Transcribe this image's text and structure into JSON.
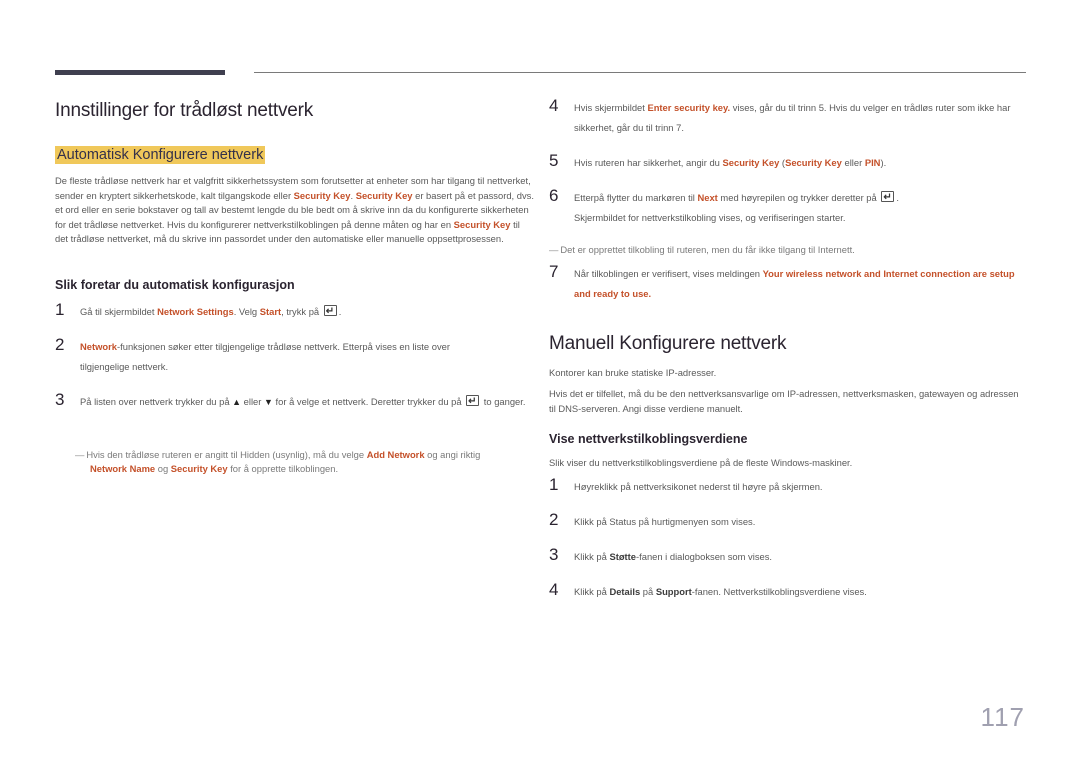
{
  "left": {
    "title": "Innstillinger for trådløst nettverk",
    "subtitle": "Automatisk Konfigurere nettverk",
    "intro": {
      "t1": "De fleste trådløse nettverk har et valgfritt sikkerhetssystem som forutsetter at enheter som har tilgang til nettverket, sender en kryptert sikkerhetskode, kalt tilgangskode eller ",
      "k1": "Security Key",
      "t2": ". ",
      "k2": "Security Key",
      "t3": " er basert på et passord, dvs. et ord eller en serie bokstaver og tall av bestemt lengde du ble bedt om å skrive inn da du konfigurerte sikkerheten for det trådløse nettverket. Hvis du konfigurerer nettverkstilkoblingen på denne måten og har en ",
      "k3": "Security Key",
      "t4": " til det trådløse nettverket, må du skrive inn passordet under den automatiske eller manuelle oppsettprosessen."
    },
    "howto_heading": "Slik foretar du automatisk konfigurasjon",
    "steps": [
      {
        "num": "1",
        "a": "Gå til skjermbildet ",
        "k1": "Network Settings",
        "b": ". Velg ",
        "k2": "Start",
        "c": ", trykk på ",
        "d": "."
      },
      {
        "num": "2",
        "k1": "Network",
        "a": "-funksjonen søker etter tilgjengelige trådløse nettverk. Etterpå vises en liste over tilgjengelige nettverk."
      },
      {
        "num": "3",
        "a": "På listen over nettverk trykker du på ",
        "up": "▲",
        "b": " eller ",
        "down": "▼",
        "c": " for å velge et nettverk. Deretter trykker du på ",
        "d": " to ganger."
      }
    ],
    "note": {
      "dash": "―",
      "a": "Hvis den trådløse ruteren er angitt til Hidden (usynlig), må du velge ",
      "k1": "Add Network",
      "b": " og angi riktig ",
      "k2": "Network Name",
      "c": " og ",
      "k3": "Security Key",
      "d": " for å opprette tilkoblingen."
    }
  },
  "right": {
    "steps": [
      {
        "num": "4",
        "a": "Hvis skjermbildet ",
        "k1": "Enter security key.",
        "b": " vises, går du til trinn 5. Hvis du velger en trådløs ruter som ikke har sikkerhet, går du til trinn 7."
      },
      {
        "num": "5",
        "a": "Hvis ruteren har sikkerhet, angir du ",
        "k1": "Security Key",
        "b": " (",
        "k2": "Security Key",
        "c": " eller ",
        "k3": "PIN",
        "d": ")."
      },
      {
        "num": "6",
        "a": "Etterpå flytter du markøren til ",
        "k1": "Next",
        "b": " med høyrepilen og trykker deretter på ",
        "c": ".",
        "line2": "Skjermbildet for nettverkstilkobling vises, og verifiseringen starter."
      },
      {
        "num": "7",
        "a": "Når tilkoblingen er verifisert, vises meldingen ",
        "k1": "Your wireless network and Internet connection are setup and ready to use."
      }
    ],
    "note": {
      "dash": "―",
      "text": "Det er opprettet tilkobling til ruteren, men du får ikke tilgang til Internett."
    },
    "manual_title": "Manuell Konfigurere nettverk",
    "manual_p1": "Kontorer kan bruke statiske IP-adresser.",
    "manual_p2": "Hvis det er tilfellet, må du be den nettverksansvarlige om IP-adressen, nettverksmasken, gatewayen og adressen til DNS-serveren. Angi disse verdiene manuelt.",
    "view_heading": "Vise nettverkstilkoblingsverdiene",
    "view_intro": "Slik viser du nettverkstilkoblingsverdiene på de fleste Windows-maskiner.",
    "view_steps": [
      {
        "num": "1",
        "a": "Høyreklikk på nettverksikonet nederst til høyre på skjermen."
      },
      {
        "num": "2",
        "a": "Klikk på Status på hurtigmenyen som vises."
      },
      {
        "num": "3",
        "a": "Klikk på ",
        "b1": "Støtte",
        "b": "-fanen i dialogboksen som vises."
      },
      {
        "num": "4",
        "a": "Klikk på ",
        "b1": "Details",
        "b": " på ",
        "b2": "Support",
        "c": "-fanen. Nettverkstilkoblingsverdiene vises."
      }
    ]
  },
  "page_number": "117",
  "icons": {
    "enter": "enter-key-icon",
    "up": "up-arrow-icon",
    "down": "down-arrow-icon"
  },
  "colors": {
    "accent": "#c4512a",
    "highlight": "#f0c85a",
    "heading": "#2b2430"
  }
}
